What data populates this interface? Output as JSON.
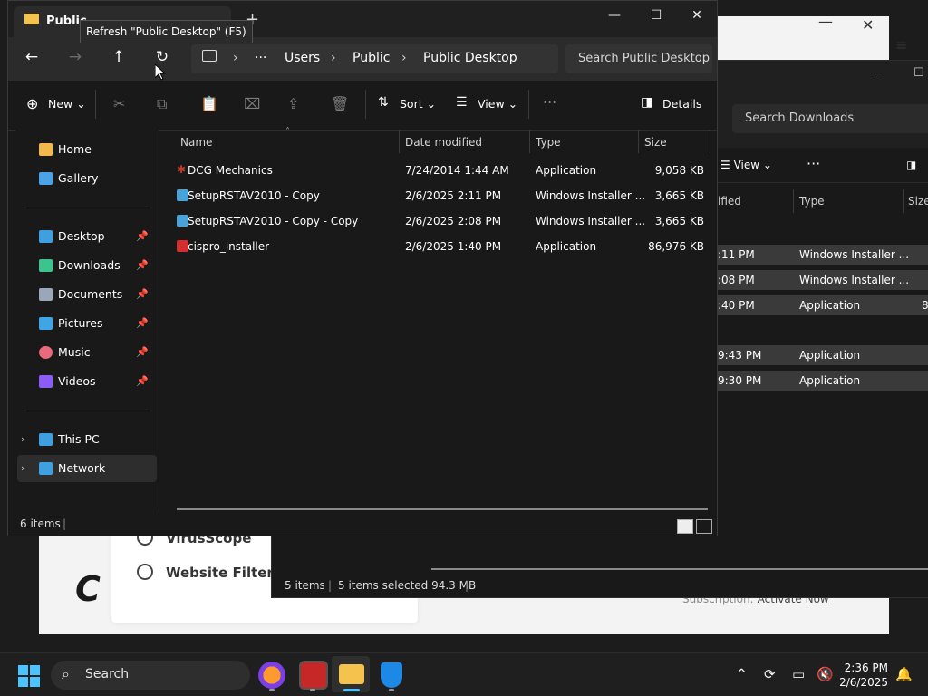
{
  "background_app": {
    "menu_items": [
      "VirusScope",
      "Website Filtering"
    ],
    "logo": "C",
    "subscription_label": "Subscription:",
    "activate_link": "Activate Now"
  },
  "downloads_window": {
    "search_placeholder": "Search Downloads",
    "view_label": "View",
    "columns": {
      "date": "ified",
      "type": "Type",
      "size": "Size"
    },
    "rows": [
      {
        "date": ":11 PM",
        "type": "Windows Installer ..."
      },
      {
        "date": ":08 PM",
        "type": "Windows Installer ..."
      },
      {
        "date": ":40 PM",
        "type": "Application",
        "size": "8"
      },
      {
        "date": "9:43 PM",
        "type": "Application"
      },
      {
        "date": "9:30 PM",
        "type": "Application"
      }
    ],
    "status": {
      "items": "5 items",
      "selected": "5 items selected  94.3 MB"
    }
  },
  "explorer": {
    "tab_title": "Public",
    "new_tab_symbol": "+",
    "window_controls": {
      "minimize": "—",
      "maximize": "☐",
      "close": "✕"
    },
    "tooltip": "Refresh \"Public Desktop\" (F5)",
    "breadcrumb": [
      "Users",
      "Public",
      "Public Desktop"
    ],
    "breadcrumb_more": "···",
    "search_placeholder": "Search Public Desktop",
    "toolbar": {
      "new": "New",
      "sort": "Sort",
      "view": "View",
      "more": "···",
      "details": "Details"
    },
    "nav": {
      "quick": [
        {
          "label": "Home",
          "icon": "home-icon",
          "color": "#f2b84b"
        },
        {
          "label": "Gallery",
          "icon": "gallery-icon",
          "color": "#4aa3e8"
        }
      ],
      "pinned": [
        {
          "label": "Desktop",
          "icon": "desktop-icon",
          "color": "#3fa0e0"
        },
        {
          "label": "Downloads",
          "icon": "download-icon",
          "color": "#3cc48f"
        },
        {
          "label": "Documents",
          "icon": "document-icon",
          "color": "#9aa7b8"
        },
        {
          "label": "Pictures",
          "icon": "pictures-icon",
          "color": "#3fa6e5"
        },
        {
          "label": "Music",
          "icon": "music-icon",
          "color": "#e86a7c"
        },
        {
          "label": "Videos",
          "icon": "videos-icon",
          "color": "#8b5cf6"
        }
      ],
      "devices": [
        {
          "label": "This PC",
          "icon": "pc-icon",
          "color": "#3fa0e0"
        },
        {
          "label": "Network",
          "icon": "network-icon",
          "color": "#3fa0e0"
        }
      ]
    },
    "columns": {
      "name": "Name",
      "date": "Date modified",
      "type": "Type",
      "size": "Size"
    },
    "files": [
      {
        "name": "DCG Mechanics",
        "date": "7/24/2014 1:44 AM",
        "type": "Application",
        "size": "9,058 KB",
        "icon_color": "#c0392b"
      },
      {
        "name": "SetupRSTAV2010 - Copy",
        "date": "2/6/2025 2:11 PM",
        "type": "Windows Installer ...",
        "size": "3,665 KB",
        "icon_color": "#4aa3d8"
      },
      {
        "name": "SetupRSTAV2010 - Copy - Copy",
        "date": "2/6/2025 2:08 PM",
        "type": "Windows Installer ...",
        "size": "3,665 KB",
        "icon_color": "#4aa3d8"
      },
      {
        "name": "cispro_installer",
        "date": "2/6/2025 1:40 PM",
        "type": "Application",
        "size": "86,976 KB",
        "icon_color": "#d32f2f"
      }
    ],
    "status": "6 items"
  },
  "taskbar": {
    "search": "Search",
    "time": "2:36 PM",
    "date": "2/6/2025"
  }
}
